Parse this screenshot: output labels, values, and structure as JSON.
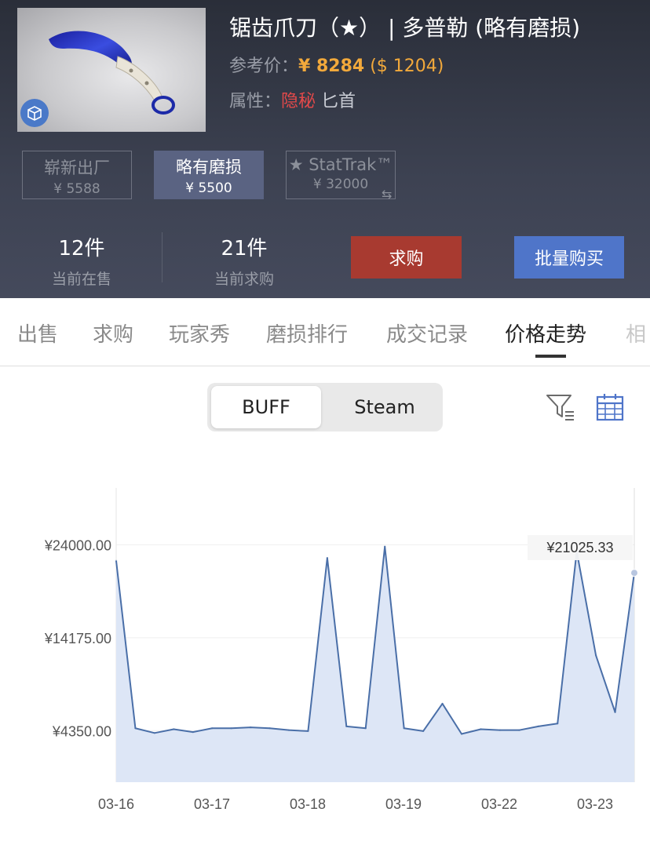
{
  "item": {
    "title": "锯齿爪刀（★） | 多普勒 (略有磨损)",
    "ref_price_label": "参考价：",
    "ref_price": "¥ 8284",
    "ref_price_usd": "($ 1204)",
    "attr_label": "属性：",
    "attr_rarity": "隐秘",
    "attr_type": "匕首"
  },
  "wear_options": [
    {
      "name": "崭新出厂",
      "price": "¥ 5588"
    },
    {
      "name": "略有磨损",
      "price": "¥ 5500"
    },
    {
      "name": "★ StatTrak™",
      "price": "¥ 32000"
    }
  ],
  "stats": {
    "on_sale_value": "12件",
    "on_sale_label": "当前在售",
    "buy_orders_value": "21件",
    "buy_orders_label": "当前求购"
  },
  "buttons": {
    "buy_order": "求购",
    "bulk_buy": "批量购买"
  },
  "tabs": [
    "出售",
    "求购",
    "玩家秀",
    "磨损排行",
    "成交记录",
    "价格走势",
    "相"
  ],
  "active_tab": "价格走势",
  "source_toggle": {
    "selected": "BUFF",
    "other": "Steam"
  },
  "icons": {
    "filter": "filter-icon",
    "calendar": "calendar-icon",
    "box": "box-icon",
    "swap": "swap-icon"
  },
  "colors": {
    "gold": "#f2a93b",
    "red": "#e2494a",
    "buy_button": "#a83a30",
    "bulk_button": "#4f75c9",
    "line": "#4a6fa8",
    "fill": "#dde6f6"
  },
  "chart_data": {
    "type": "area",
    "y_ticks": [
      "¥24000.00",
      "¥14175.00",
      "¥4350.00"
    ],
    "y_tick_values": [
      24000,
      14175,
      4350
    ],
    "x_tick_labels": [
      "03-16",
      "03-17",
      "03-18",
      "03-19",
      "03-22",
      "03-23"
    ],
    "tooltip": "¥21025.33",
    "ylim": [
      -1100,
      30000
    ],
    "values": [
      22300,
      4600,
      4100,
      4500,
      4200,
      4600,
      4600,
      4700,
      4600,
      4400,
      4300,
      22600,
      4800,
      4600,
      23800,
      4600,
      4300,
      7200,
      4000,
      4500,
      4400,
      4400,
      4800,
      5100,
      23300,
      12300,
      6300,
      21025.33
    ]
  }
}
